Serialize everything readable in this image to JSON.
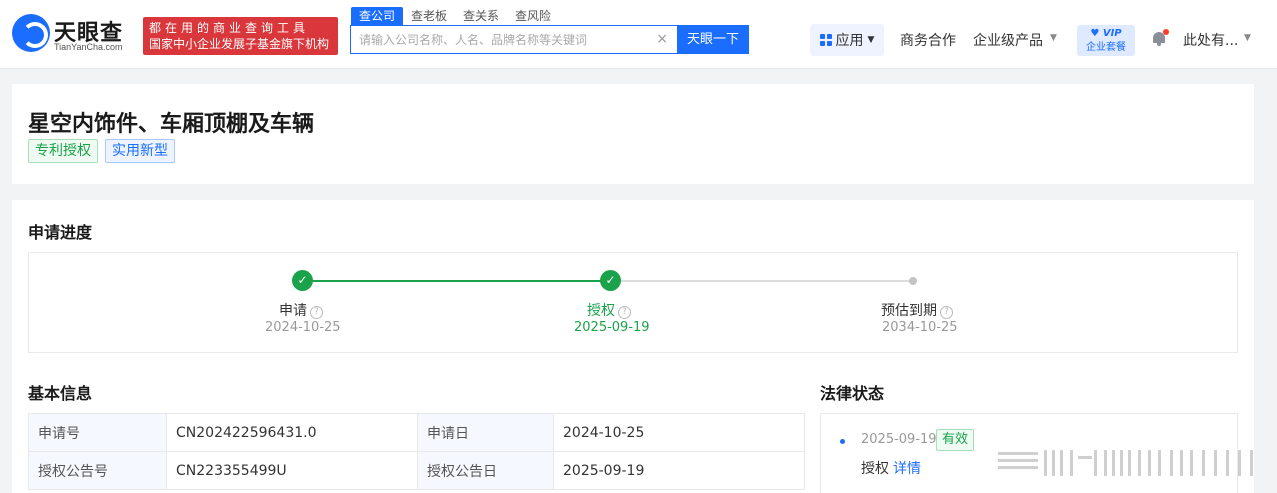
{
  "brand": {
    "name": "天眼查",
    "domain": "TianYanCha.com",
    "slogan_line1": "都在用的商业查询工具",
    "slogan_line2": "国家中小企业发展子基金旗下机构"
  },
  "search": {
    "tabs": [
      "查公司",
      "查老板",
      "查关系",
      "查风险"
    ],
    "active_tab": "查公司",
    "placeholder": "请输入公司名称、人名、品牌名称等关键词",
    "button": "天眼一下"
  },
  "nav": {
    "app": "应用",
    "business": "商务合作",
    "enterprise": "企业级产品",
    "vip_top": "VIP",
    "vip_bottom": "企业套餐",
    "user": "此处有..."
  },
  "patent": {
    "title": "星空内饰件、车厢顶棚及车辆",
    "tags": [
      "专利授权",
      "实用新型"
    ]
  },
  "progress": {
    "section_title": "申请进度",
    "steps": [
      {
        "label": "申请",
        "date": "2024-10-25",
        "status": "done"
      },
      {
        "label": "授权",
        "date": "2025-09-19",
        "status": "current"
      },
      {
        "label": "预估到期",
        "date": "2034-10-25",
        "status": "pending"
      }
    ]
  },
  "basic_info": {
    "section_title": "基本信息",
    "rows": [
      {
        "k1": "申请号",
        "v1": "CN202422596431.0",
        "k2": "申请日",
        "v2": "2024-10-25"
      },
      {
        "k1": "授权公告号",
        "v1": "CN223355499U",
        "k2": "授权公告日",
        "v2": "2025-09-19"
      }
    ]
  },
  "legal": {
    "section_title": "法律状态",
    "date": "2025-09-19",
    "badge": "有效",
    "text": "授权",
    "link": "详情"
  },
  "colors": {
    "primary": "#1a6dff",
    "success": "#1aa34a",
    "slogan_bg": "#d9373b"
  }
}
